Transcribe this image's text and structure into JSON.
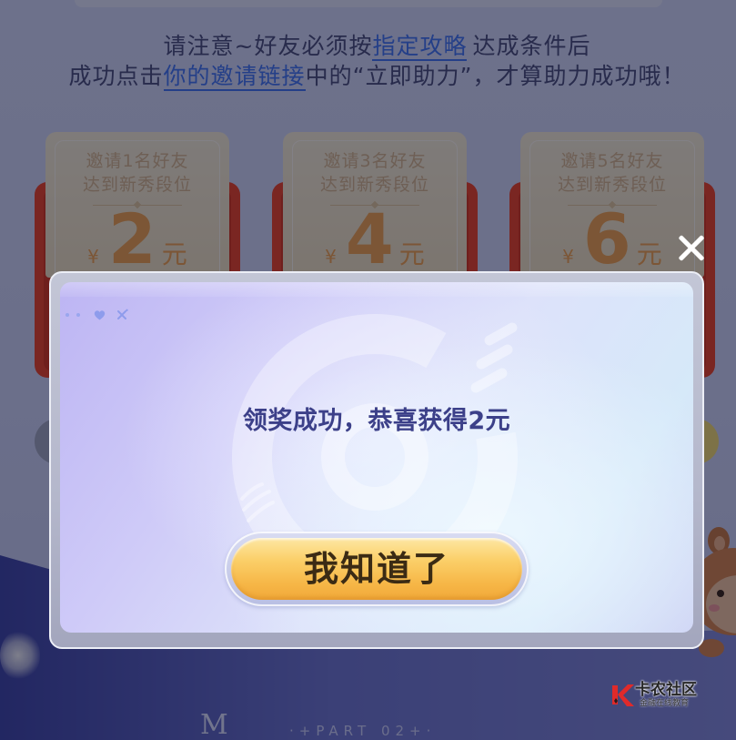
{
  "notice": {
    "line1": {
      "before": "请注意~好友必须按",
      "link": "指定攻略",
      "after": "达成条件后"
    },
    "line2": {
      "before": "成功点击",
      "link": "你的邀请链接",
      "after": "中的“立即助力”，才算助力成功哦！"
    }
  },
  "reward_cards": [
    {
      "title": "邀请1名好友",
      "condition": "达到新秀段位",
      "currency": "¥",
      "amount": "2",
      "unit": "元"
    },
    {
      "title": "邀请3名好友",
      "condition": "达到新秀段位",
      "currency": "¥",
      "amount": "4",
      "unit": "元"
    },
    {
      "title": "邀请5名好友",
      "condition": "达到新秀段位",
      "currency": "¥",
      "amount": "6",
      "unit": "元"
    }
  ],
  "section": {
    "letter": "M",
    "part_label": "·+PART 02+·"
  },
  "modal": {
    "close_icon": "close-icon",
    "decor_icons": [
      "dot-icon",
      "dot-icon",
      "heart-icon",
      "sparkle-icon"
    ],
    "message": "领奖成功，恭喜获得2元",
    "confirm_label": "我知道了"
  },
  "watermark": {
    "logo_icon": "kanong-logo-icon",
    "name": "卡农社区",
    "subtitle": "金融在线教育"
  },
  "colors": {
    "overlay": "rgba(6,8,28,0.5)",
    "link": "#4376f5",
    "message": "#3c4089",
    "button_gold": "#f6b646",
    "card_red": "#ee4429",
    "amount": "#f2a450"
  }
}
